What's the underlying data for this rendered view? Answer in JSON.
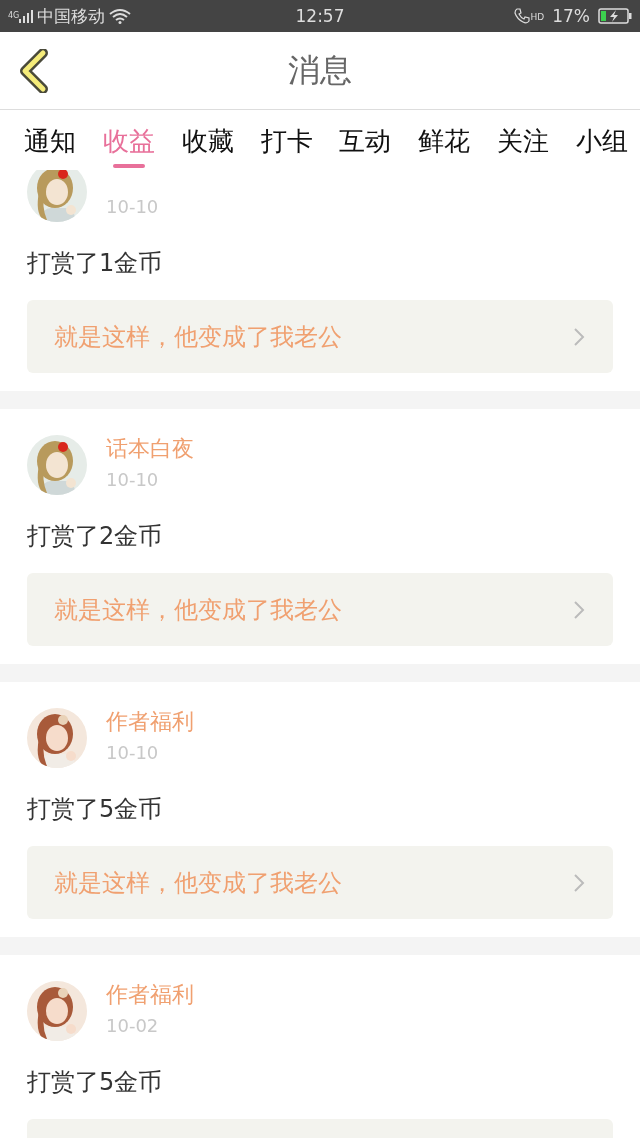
{
  "status_bar": {
    "network": "4G",
    "carrier": "中国移动",
    "time": "12:57",
    "hd": "HD",
    "battery": "17%",
    "charging": true
  },
  "header": {
    "title": "消息"
  },
  "tabs": [
    {
      "label": "通知",
      "selected": false
    },
    {
      "label": "收益",
      "selected": true
    },
    {
      "label": "收藏",
      "selected": false
    },
    {
      "label": "打卡",
      "selected": false
    },
    {
      "label": "互动",
      "selected": false
    },
    {
      "label": "鲜花",
      "selected": false
    },
    {
      "label": "关注",
      "selected": false
    },
    {
      "label": "小组",
      "selected": false
    }
  ],
  "messages": [
    {
      "date": "10-10",
      "text": "打赏了1金币",
      "link": "就是这样，他变成了我老公"
    },
    {
      "sender": "话本白夜",
      "date": "10-10",
      "text": "打赏了2金币",
      "link": "就是这样，他变成了我老公"
    },
    {
      "sender": "作者福利",
      "date": "10-10",
      "text": "打赏了5金币",
      "link": "就是这样，他变成了我老公"
    },
    {
      "sender": "作者福利",
      "date": "10-02",
      "text": "打赏了5金币"
    }
  ]
}
